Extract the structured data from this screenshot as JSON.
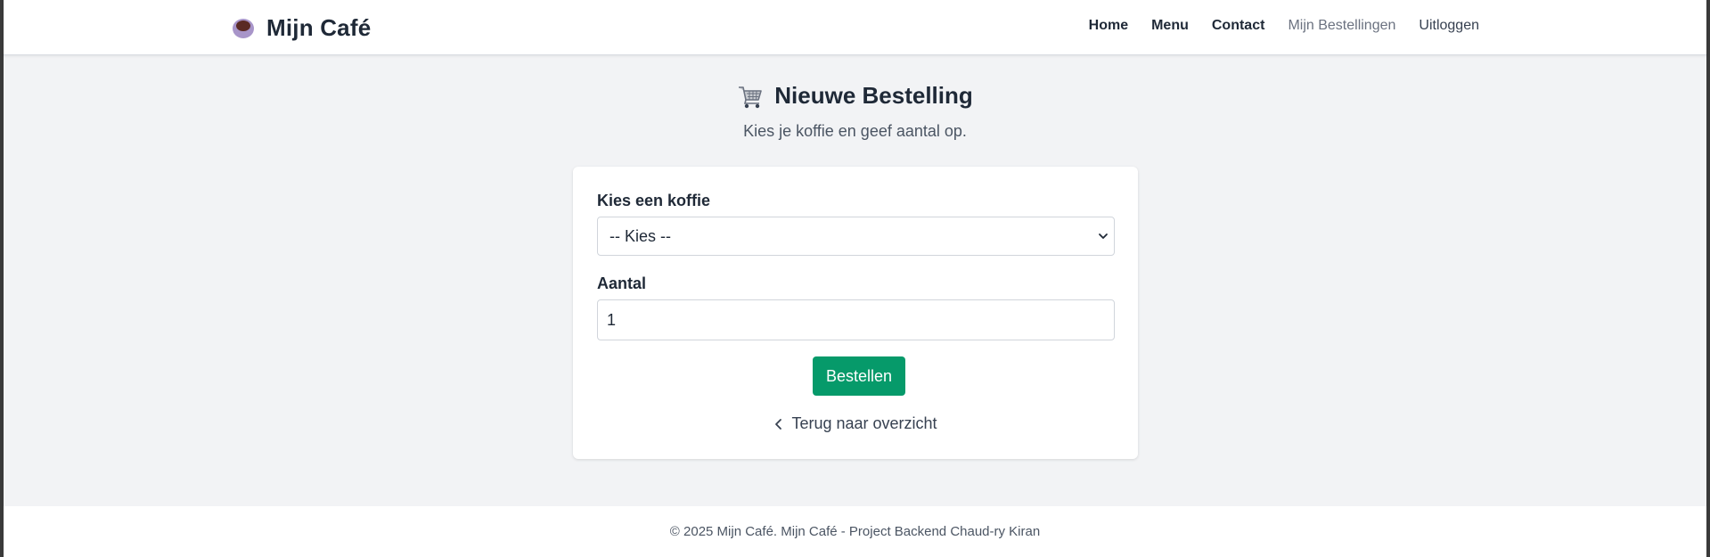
{
  "brand": {
    "name": "Mijn Café",
    "icon": "coffee-cup-icon"
  },
  "nav": {
    "items": [
      {
        "label": "Home"
      },
      {
        "label": "Menu"
      },
      {
        "label": "Contact"
      },
      {
        "label": "Mijn Bestellingen"
      },
      {
        "label": "Uitloggen"
      }
    ]
  },
  "header": {
    "icon": "shopping-cart-icon",
    "title": "Nieuwe Bestelling",
    "subtitle": "Kies je koffie en geef aantal op."
  },
  "form": {
    "coffee_label": "Kies een koffie",
    "coffee_selected": "-- Kies --",
    "quantity_label": "Aantal",
    "quantity_value": "1",
    "submit_label": "Bestellen",
    "back_label": "Terug naar overzicht"
  },
  "footer": {
    "text": "© 2025 Mijn Café. Mijn Café - Project Backend Chaud-ry Kiran"
  },
  "colors": {
    "accent_button": "#069a6a",
    "page_background": "#f2f3f5",
    "cup": "#a895c9",
    "coffee": "#5a2a24"
  }
}
